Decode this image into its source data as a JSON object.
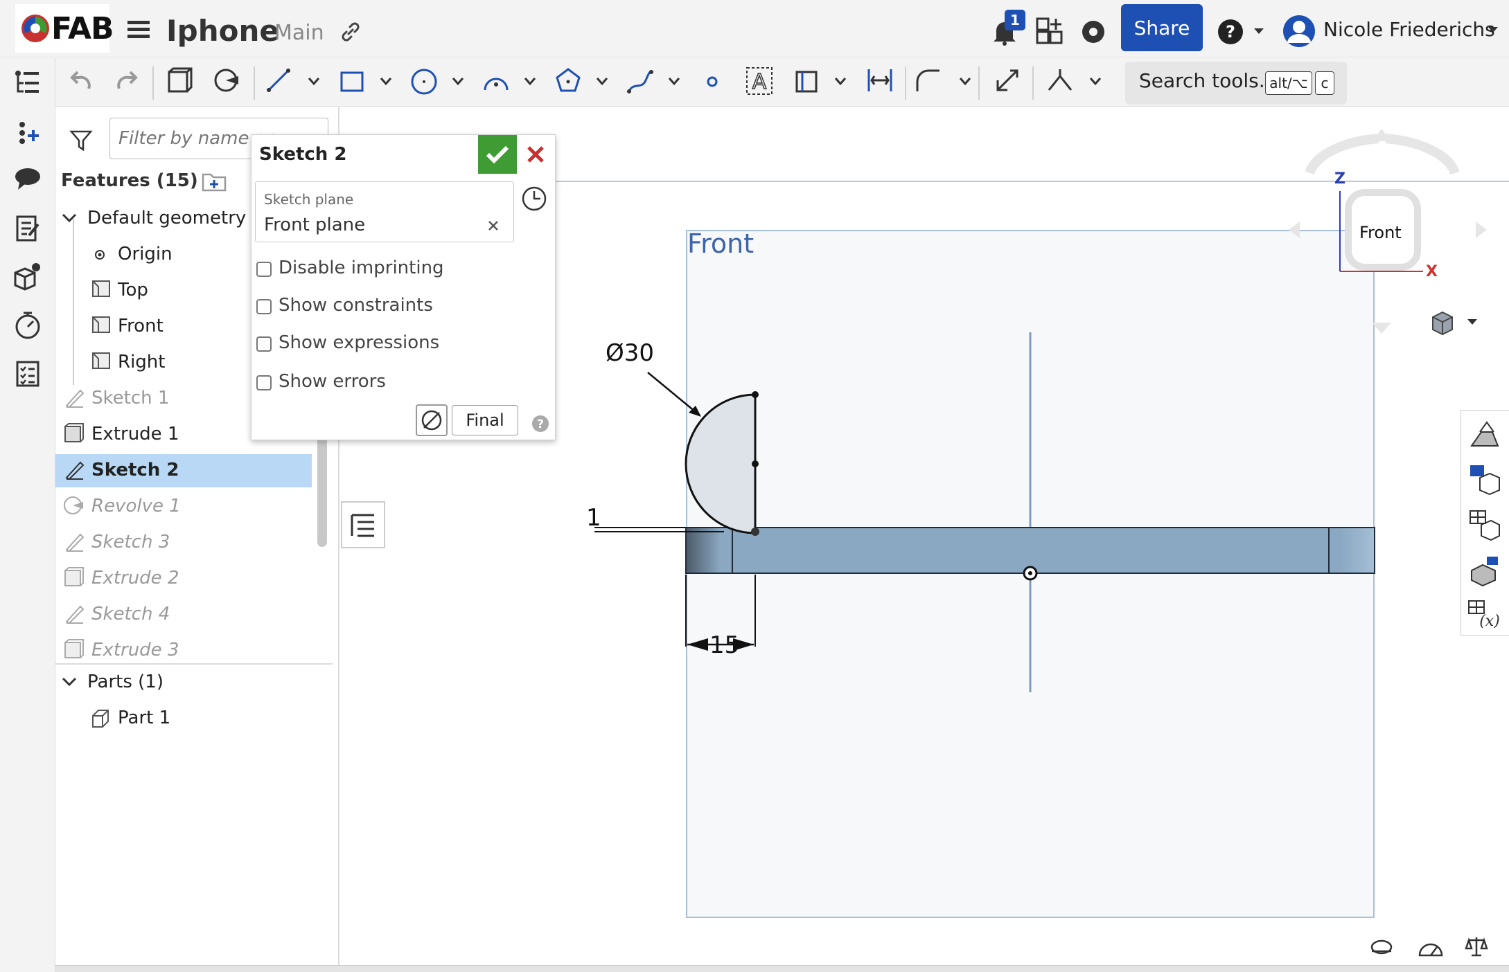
{
  "app": {
    "logo_text": "FAB",
    "document_title": "Iphone",
    "branch": "Main",
    "notification_count": "1",
    "share_label": "Share",
    "user_name": "Nicole Friederichs"
  },
  "toolbar": {
    "search_label": "Search tools...",
    "shortcut_key1": "alt/⌥",
    "shortcut_key2": "c"
  },
  "feature_panel": {
    "filter_placeholder": "Filter by name or",
    "features_header": "Features (15)",
    "default_geometry": "Default geometry",
    "items": [
      {
        "label": "Origin",
        "state": "normal"
      },
      {
        "label": "Top",
        "state": "normal"
      },
      {
        "label": "Front",
        "state": "normal"
      },
      {
        "label": "Right",
        "state": "normal"
      },
      {
        "label": "Sketch 1",
        "state": "dim"
      },
      {
        "label": "Extrude 1",
        "state": "normal"
      },
      {
        "label": "Sketch 2",
        "state": "selected"
      },
      {
        "label": "Revolve 1",
        "state": "suppressed"
      },
      {
        "label": "Sketch 3",
        "state": "suppressed"
      },
      {
        "label": "Extrude 2",
        "state": "suppressed"
      },
      {
        "label": "Sketch 4",
        "state": "suppressed"
      },
      {
        "label": "Extrude 3",
        "state": "suppressed"
      }
    ],
    "parts_header": "Parts (1)",
    "parts": [
      {
        "label": "Part 1"
      }
    ]
  },
  "sketch_dialog": {
    "title": "Sketch 2",
    "plane_label": "Sketch plane",
    "plane_value": "Front plane",
    "options": [
      {
        "label": "Disable imprinting",
        "checked": false
      },
      {
        "label": "Show constraints",
        "checked": false
      },
      {
        "label": "Show expressions",
        "checked": false
      },
      {
        "label": "Show errors",
        "checked": false
      }
    ],
    "final_label": "Final"
  },
  "viewport": {
    "plane_name": "Front",
    "dim_diameter": "Ø30",
    "dim_offset": "1",
    "dim_width": "15",
    "viewcube_face": "Front",
    "axis_z": "Z",
    "axis_x": "X"
  },
  "colors": {
    "accent": "#1e50b4",
    "confirm": "#3f9c35",
    "cancel": "#c8312f",
    "selection": "#b8d8f5",
    "plane_border": "#a9bfdc",
    "part_fill": "#8aa8c2"
  }
}
